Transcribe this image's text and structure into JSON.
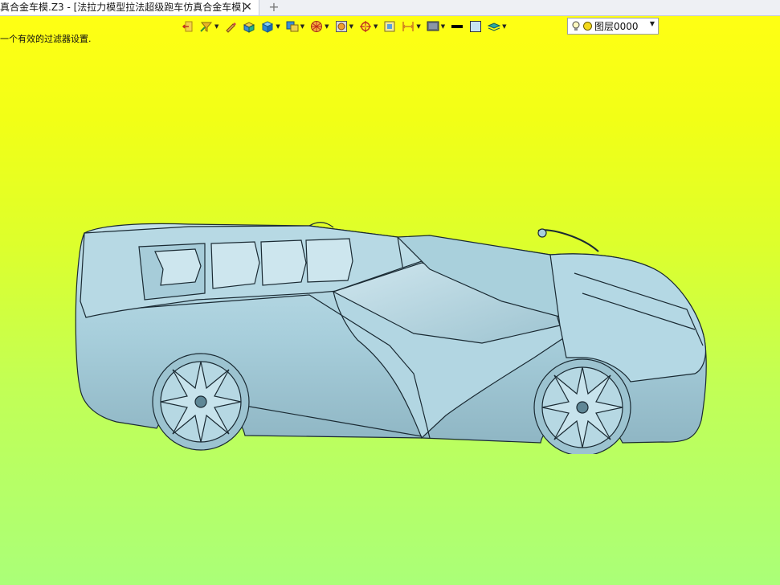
{
  "tab": {
    "title": "真合金车模.Z3 - [法拉力模型拉法超级跑车仿真合金车模]",
    "close_glyph": "✕",
    "add_glyph": "+"
  },
  "status": {
    "message": "一个有效的过滤器设置."
  },
  "toolbar": {
    "items": [
      {
        "name": "exit-icon"
      },
      {
        "name": "filter-icon"
      },
      {
        "name": "pencil-icon"
      },
      {
        "name": "shaded-face-icon"
      },
      {
        "name": "shaded-solid-icon"
      },
      {
        "name": "view-mode-icon"
      },
      {
        "name": "globe-icon"
      },
      {
        "name": "snap-icon"
      },
      {
        "name": "target-icon"
      },
      {
        "name": "dimension-icon"
      },
      {
        "name": "measure-icon"
      },
      {
        "name": "display-icon"
      },
      {
        "name": "line-color-swatch"
      },
      {
        "name": "fill-color-swatch"
      },
      {
        "name": "layer-stack-icon"
      }
    ],
    "layer": {
      "name": "图层0000",
      "color": "#f3d81c"
    }
  },
  "colors": {
    "car_body": "#a8cfdc",
    "car_edge": "#1a2a33",
    "bg_top": "#ffff14",
    "bg_bottom": "#aaff78"
  }
}
